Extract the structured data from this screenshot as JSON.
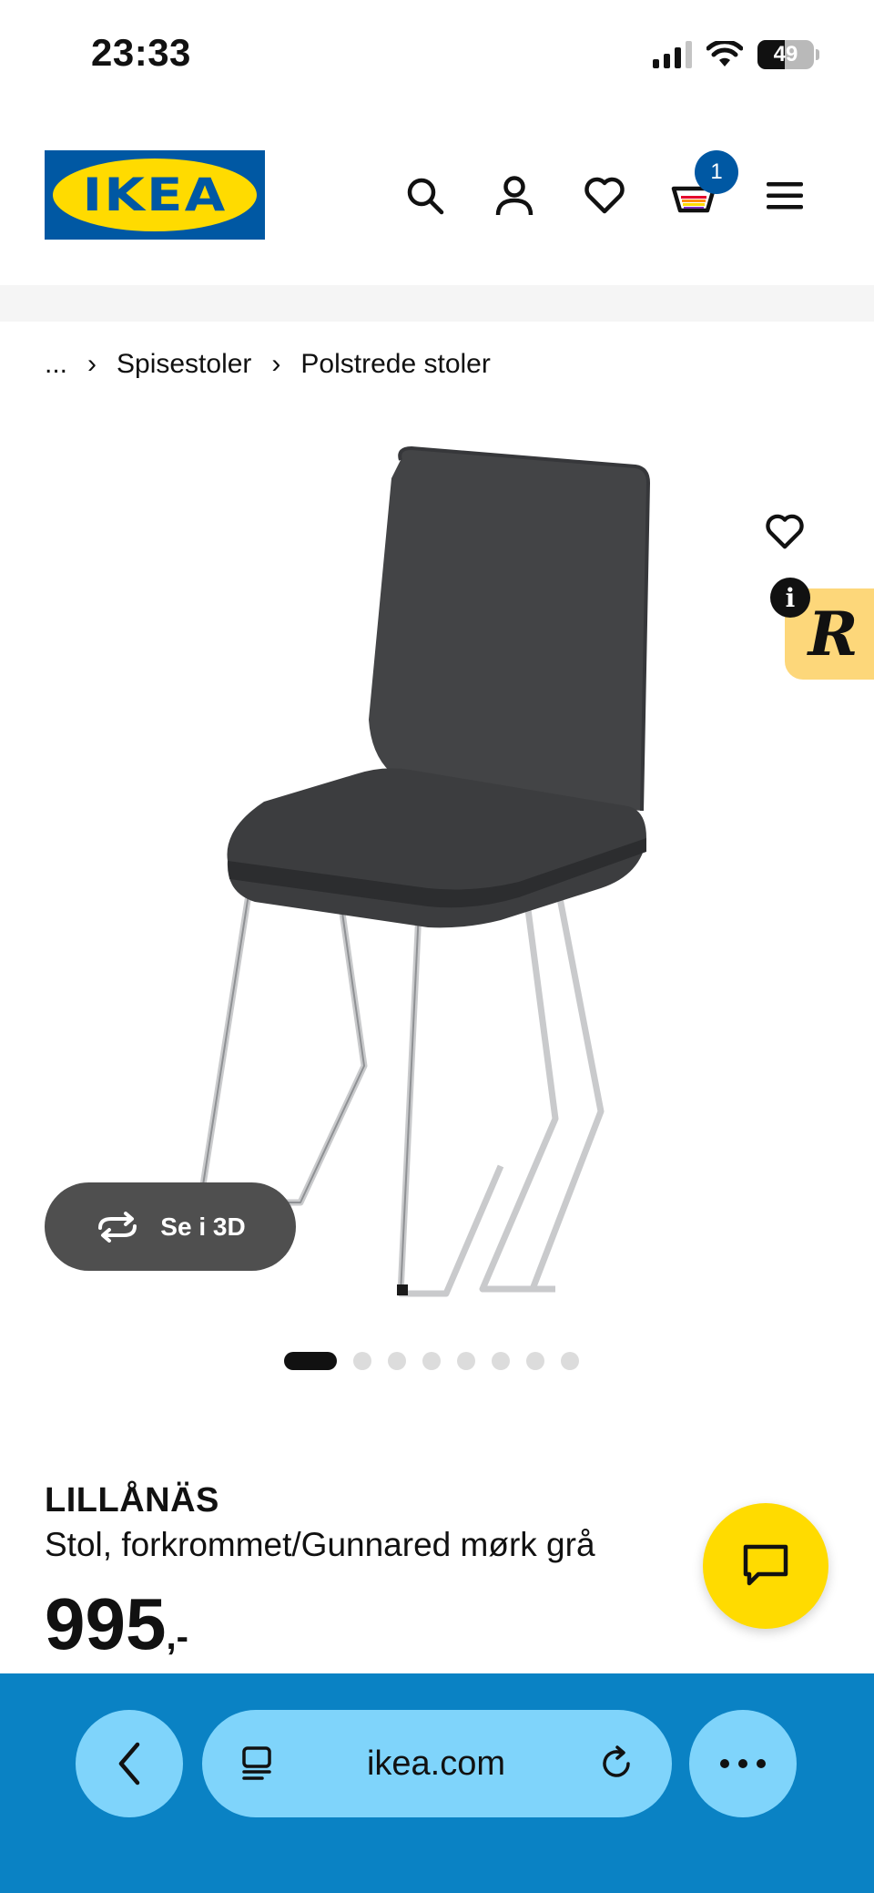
{
  "status_bar": {
    "time": "23:33",
    "battery": "49"
  },
  "header": {
    "logo_text": "IKEA",
    "cart_count": "1"
  },
  "breadcrumb": {
    "ellipsis": "...",
    "items": [
      "Spisestoler",
      "Polstrede stoler"
    ]
  },
  "gallery": {
    "view_3d_label": "Se i 3D",
    "image_count": 8,
    "active_index": 0
  },
  "product": {
    "name": "LILLÅNÄS",
    "description": "Stol, forkrommet/Gunnared mørk grå",
    "price": "995",
    "price_suffix": ",-"
  },
  "browser": {
    "url": "ikea.com"
  },
  "colors": {
    "ikea_blue": "#0058a3",
    "ikea_yellow": "#ffdb00",
    "browser_bar": "#0a82c4",
    "browser_button": "#7fd4fb"
  }
}
